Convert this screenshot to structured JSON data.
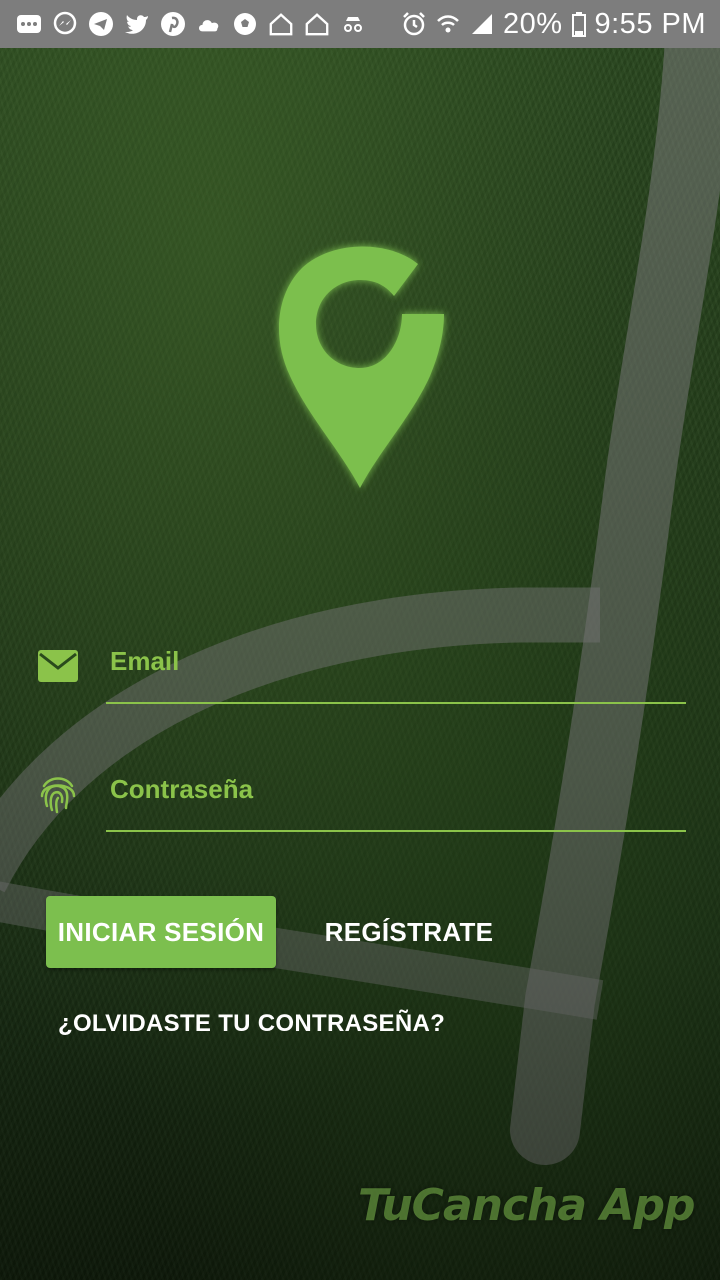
{
  "status_bar": {
    "battery_percent": "20%",
    "time": "9:55 PM",
    "left_icons": [
      "more-icon",
      "messenger-icon",
      "telegram-icon",
      "twitter-icon",
      "pinterest-icon",
      "cloud-icon",
      "soccer-ball-icon",
      "home-icon",
      "home-icon",
      "incognito-icon"
    ],
    "right_icons": [
      "alarm-icon",
      "wifi-icon",
      "signal-icon",
      "battery-icon"
    ]
  },
  "login": {
    "email_placeholder": "Email",
    "password_placeholder": "Contraseña",
    "login_button": "INICIAR SESIÓN",
    "register_button": "REGÍSTRATE",
    "forgot_password": "¿OLVIDASTE TU CONTRASEÑA?"
  },
  "watermark": "TuCancha App",
  "colors": {
    "accent": "#8bc34a",
    "button": "#7cbf4e",
    "status_bar": "#7d7d7d"
  }
}
